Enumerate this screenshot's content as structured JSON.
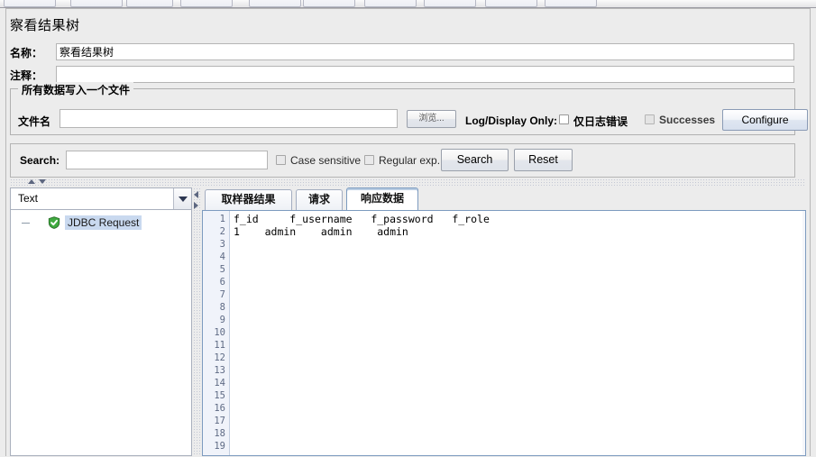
{
  "window": {
    "title": "察看结果树"
  },
  "form": {
    "name_label": "名称：",
    "name_value": "察看结果树",
    "comment_label": "注释：",
    "comment_value": ""
  },
  "file_group": {
    "title": "所有数据写入一个文件",
    "filename_label": "文件名",
    "filename_value": "",
    "browse_button": "浏览...",
    "log_display_only_label": "Log/Display Only:",
    "error_logs_checkbox": "仅日志错误",
    "error_logs_checked": false,
    "successes_checkbox": "Successes",
    "successes_checked": false,
    "configure_button": "Configure"
  },
  "search": {
    "label": "Search:",
    "value": "",
    "case_sensitive_label": "Case sensitive",
    "case_sensitive_checked": false,
    "regular_exp_label": "Regular exp.",
    "regular_exp_checked": false,
    "search_button": "Search",
    "reset_button": "Reset"
  },
  "tree": {
    "renderer_selected": "Text",
    "renderer_options": [
      "Text"
    ],
    "nodes": [
      {
        "label": "JDBC Request",
        "status": "success",
        "icon": "green-shield-check-icon"
      }
    ]
  },
  "results": {
    "tabs": [
      {
        "label": "取样器结果",
        "active": false
      },
      {
        "label": "请求",
        "active": false
      },
      {
        "label": "响应数据",
        "active": true
      }
    ],
    "active_tab_index": 2,
    "line_numbers": [
      "1",
      "2",
      "3",
      "4",
      "5",
      "6",
      "7",
      "8",
      "9",
      "10",
      "11",
      "12",
      "13",
      "14",
      "15",
      "16",
      "17",
      "18",
      "19"
    ],
    "content_lines": [
      "f_id     f_username   f_password   f_role",
      "1    admin    admin    admin",
      "",
      "",
      "",
      "",
      "",
      "",
      "",
      "",
      "",
      "",
      "",
      "",
      "",
      "",
      "",
      "",
      ""
    ]
  },
  "colors": {
    "background": "#ececec",
    "panel_border": "#b8b8b8",
    "field_background": "#ffffff",
    "tab_active_border": "#7d9bbf",
    "selection": "#c9d9ef",
    "success_green": "#3faa3f",
    "gutter_text": "#5f6b85"
  }
}
